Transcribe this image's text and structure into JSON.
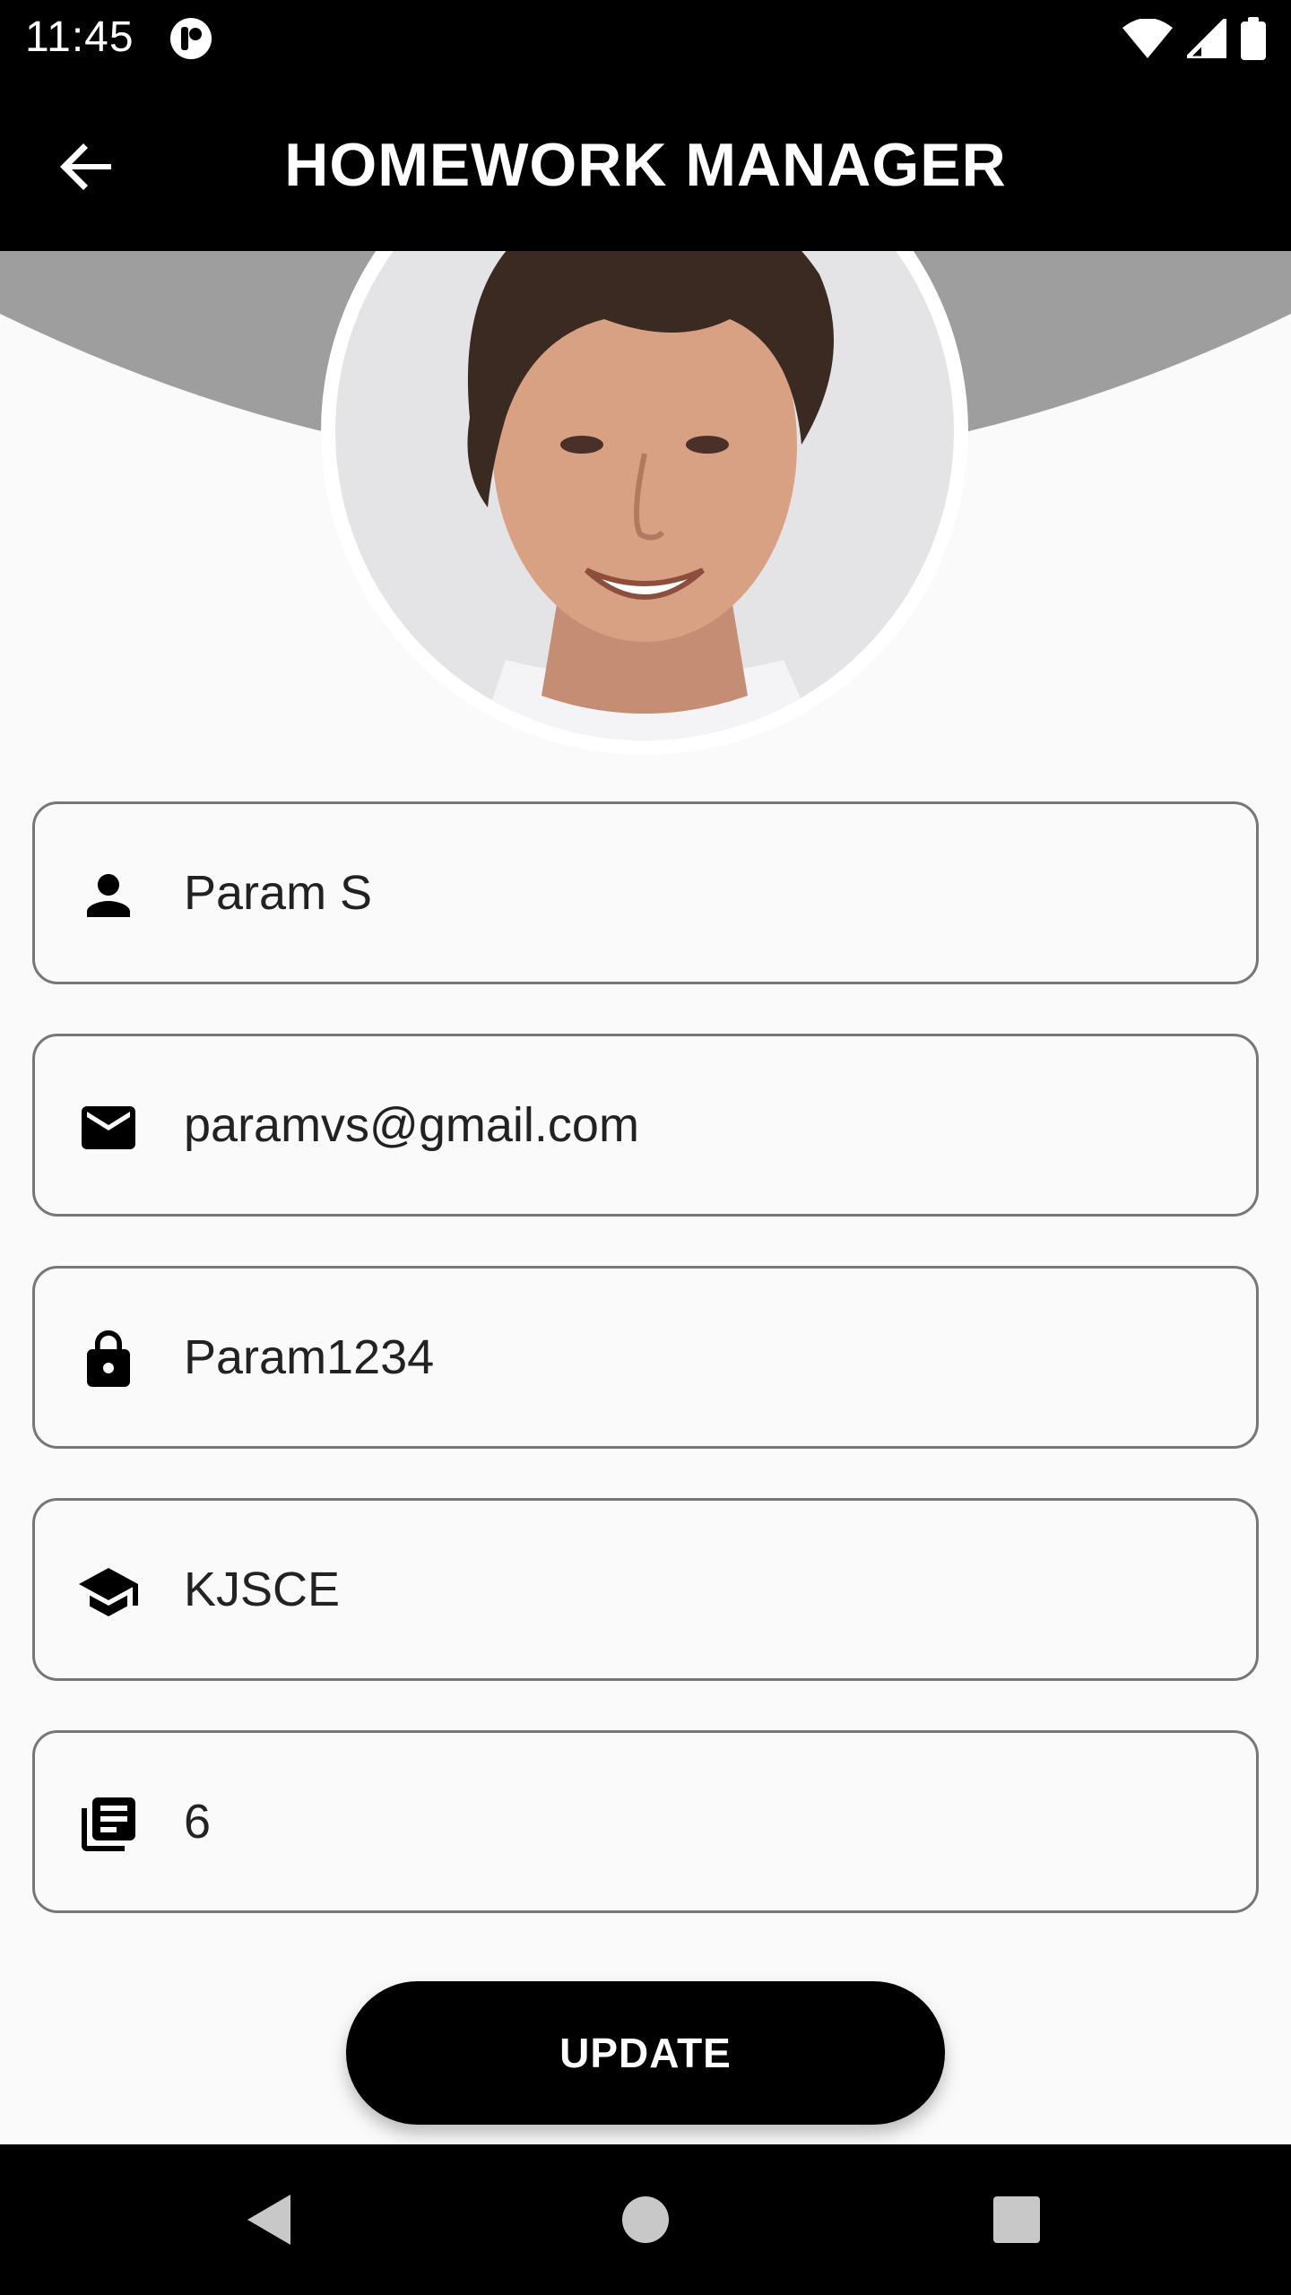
{
  "status_bar": {
    "time": "11:45",
    "icons": [
      "app-notification-icon",
      "wifi-icon",
      "signal-icon",
      "battery-icon"
    ]
  },
  "app_bar": {
    "title": "HOMEWORK MANAGER",
    "back_icon": "arrow-back-icon"
  },
  "profile": {
    "avatar": "profile-photo"
  },
  "fields": [
    {
      "icon": "person-icon",
      "value": "Param S"
    },
    {
      "icon": "email-icon",
      "value": "paramvs@gmail.com"
    },
    {
      "icon": "lock-icon",
      "value": "Param1234"
    },
    {
      "icon": "school-icon",
      "value": "KJSCE"
    },
    {
      "icon": "library-books-icon",
      "value": "6"
    }
  ],
  "update_button": {
    "label": "UPDATE"
  },
  "nav_bar": {
    "items": [
      "back-nav-icon",
      "home-nav-icon",
      "recents-nav-icon"
    ]
  },
  "colors": {
    "bar_background": "#000000",
    "page_background": "#fafafa",
    "header_arc": "#9e9e9e",
    "field_border": "#777777"
  }
}
